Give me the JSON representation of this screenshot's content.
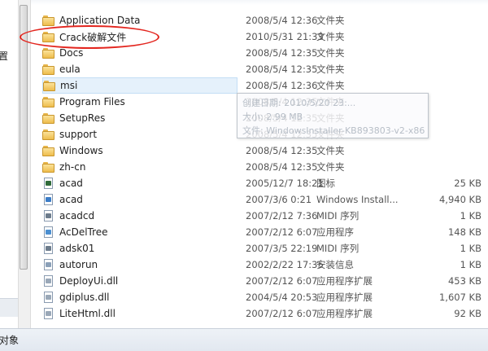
{
  "nav_pane": {
    "partial_text": "置"
  },
  "status_bar": {
    "text": "对象"
  },
  "files": [
    {
      "name": "Application Data",
      "date": "2008/5/4 12:36",
      "type": "文件夹",
      "size": "",
      "icon": "folder-icon"
    },
    {
      "name": "Crack破解文件",
      "date": "2010/5/31 21:33",
      "type": "文件夹",
      "size": "",
      "icon": "folder-icon"
    },
    {
      "name": "Docs",
      "date": "2008/5/4 12:35",
      "type": "文件夹",
      "size": "",
      "icon": "folder-icon"
    },
    {
      "name": "eula",
      "date": "2008/5/4 12:35",
      "type": "文件夹",
      "size": "",
      "icon": "folder-icon"
    },
    {
      "name": "msi",
      "date": "2008/5/4 12:36",
      "type": "文件夹",
      "size": "",
      "icon": "folder-icon"
    },
    {
      "name": "Program Files",
      "date": "2008/5/4 12:35",
      "type": "文件夹",
      "size": "",
      "icon": "folder-icon"
    },
    {
      "name": "SetupRes",
      "date": "2008/5/4 12:35",
      "type": "文件夹",
      "size": "",
      "icon": "folder-icon"
    },
    {
      "name": "support",
      "date": "2008/5/4 12:35",
      "type": "文件夹",
      "size": "",
      "icon": "folder-icon"
    },
    {
      "name": "Windows",
      "date": "2008/5/4 12:35",
      "type": "文件夹",
      "size": "",
      "icon": "folder-icon"
    },
    {
      "name": "zh-cn",
      "date": "2008/5/4 12:35",
      "type": "文件夹",
      "size": "",
      "icon": "folder-icon"
    },
    {
      "name": "acad",
      "date": "2005/12/7 18:21",
      "type": "图标",
      "size": "25 KB",
      "icon": "autocad-icon"
    },
    {
      "name": "acad",
      "date": "2007/3/6 0:21",
      "type": "Windows Install...",
      "size": "4,940 KB",
      "icon": "installer-icon"
    },
    {
      "name": "acadcd",
      "date": "2007/2/12 7:36",
      "type": "MIDI 序列",
      "size": "1 KB",
      "icon": "midi-file-icon"
    },
    {
      "name": "AcDelTree",
      "date": "2007/2/12 6:07",
      "type": "应用程序",
      "size": "148 KB",
      "icon": "application-icon"
    },
    {
      "name": "adsk01",
      "date": "2007/3/5 22:19",
      "type": "MIDI 序列",
      "size": "1 KB",
      "icon": "midi-file-icon"
    },
    {
      "name": "autorun",
      "date": "2002/2/22 17:35",
      "type": "安装信息",
      "size": "1 KB",
      "icon": "setup-info-icon"
    },
    {
      "name": "DeployUi.dll",
      "date": "2007/2/12 6:07",
      "type": "应用程序扩展",
      "size": "453 KB",
      "icon": "dll-file-icon"
    },
    {
      "name": "gdiplus.dll",
      "date": "2004/5/4 20:53",
      "type": "应用程序扩展",
      "size": "1,607 KB",
      "icon": "dll-file-icon"
    },
    {
      "name": "LiteHtml.dll",
      "date": "2007/2/12 6:07",
      "type": "应用程序扩展",
      "size": "92 KB",
      "icon": "dll-file-icon"
    }
  ],
  "tooltip": {
    "lines": [
      "创建日期: 2010/5/20 23:...",
      "大小: 2.99 MB",
      "文件: WindowsInstaller-KB893803-v2-x86"
    ]
  }
}
